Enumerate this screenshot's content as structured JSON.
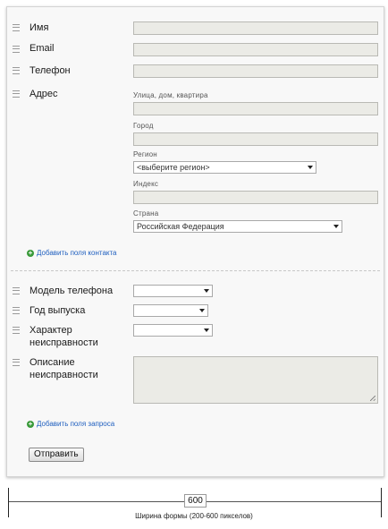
{
  "form": {
    "fields": {
      "name_label": "Имя",
      "email_label": "Email",
      "phone_label": "Телефон",
      "address_label": "Адрес",
      "street_label": "Улица, дом, квартира",
      "city_label": "Город",
      "region_label": "Регион",
      "region_value": "<выберите регион>",
      "index_label": "Индекс",
      "country_label": "Страна",
      "country_value": "Российская Федерация"
    },
    "add_contact_fields": "Добавить поля контакта",
    "request": {
      "phone_model_label": "Модель телефона",
      "year_label": "Год выпуска",
      "fault_type_label": "Характер неисправности",
      "description_label": "Описание неисправности"
    },
    "add_request_fields": "Добавить поля запроса",
    "submit_label": "Отправить"
  },
  "ruler": {
    "width_value": "600",
    "caption": "Ширина формы (200-600 пикселов)"
  },
  "colors": {
    "panel_bg": "#f8f8f8",
    "field_bg": "#ebebe6",
    "link": "#1f5fbf",
    "plus_icon": "#3a9a3a"
  },
  "icons": [
    "drag-handle-icon",
    "plus-icon",
    "dropdown-arrow-icon",
    "resize-grip-icon"
  ]
}
